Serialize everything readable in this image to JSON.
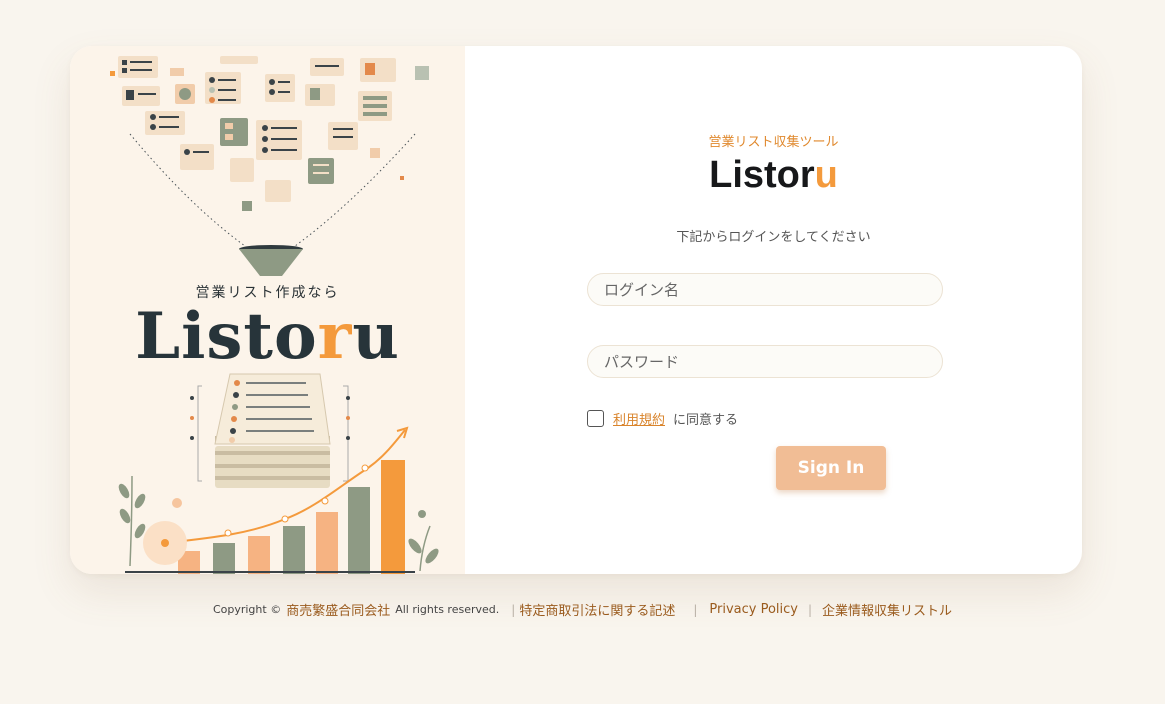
{
  "hero": {
    "tagline": "営業リスト作成なら",
    "logo_main": "Listo",
    "logo_accent": "r",
    "logo_tail": "u"
  },
  "login": {
    "subtitle": "営業リスト収集ツール",
    "brand_main": "Listor",
    "brand_accent": "u",
    "instruction": "下記からログインをしてください",
    "login_placeholder": "ログイン名",
    "password_placeholder": "パスワード",
    "terms_link": "利用規約",
    "terms_suffix": "に同意する",
    "terms_checked": false,
    "signin_label": "Sign In"
  },
  "footer": {
    "copyright_prefix": "Copyright ©",
    "company": "商売繁盛合同会社",
    "rights": "All rights reserved.",
    "links": [
      "特定商取引法に関する記述",
      "Privacy Policy",
      "企業情報収集リストル"
    ]
  },
  "colors": {
    "accent": "#f49a3c",
    "page_bg": "#f9f5ee",
    "hero_bg": "#fcf4ea",
    "button": "#f1bd95",
    "sage": "#8e9a84"
  }
}
